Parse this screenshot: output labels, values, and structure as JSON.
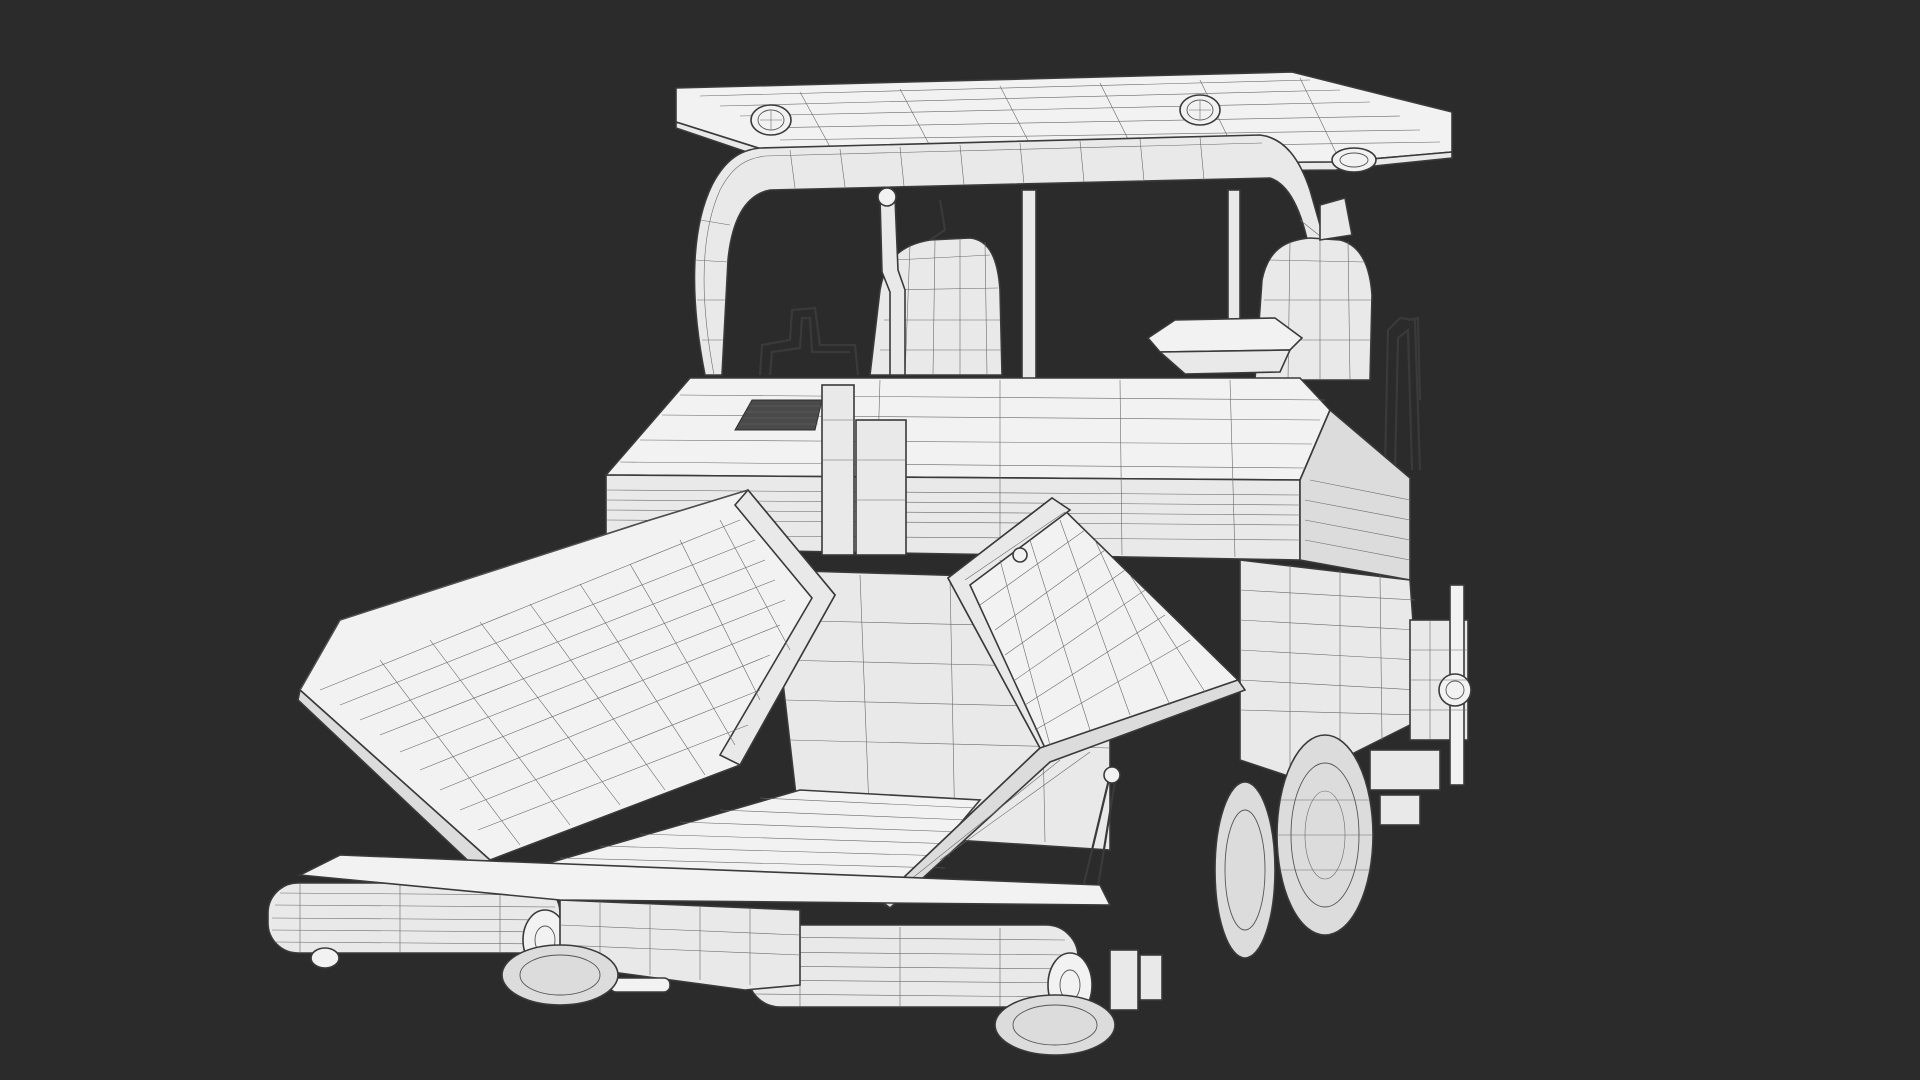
{
  "scene": {
    "subject": "asphalt-paver-wireframe",
    "background_color": "#2b2b2b",
    "model_fill_color": "#e9e9e9",
    "wire_color": "#3a3a3a"
  }
}
